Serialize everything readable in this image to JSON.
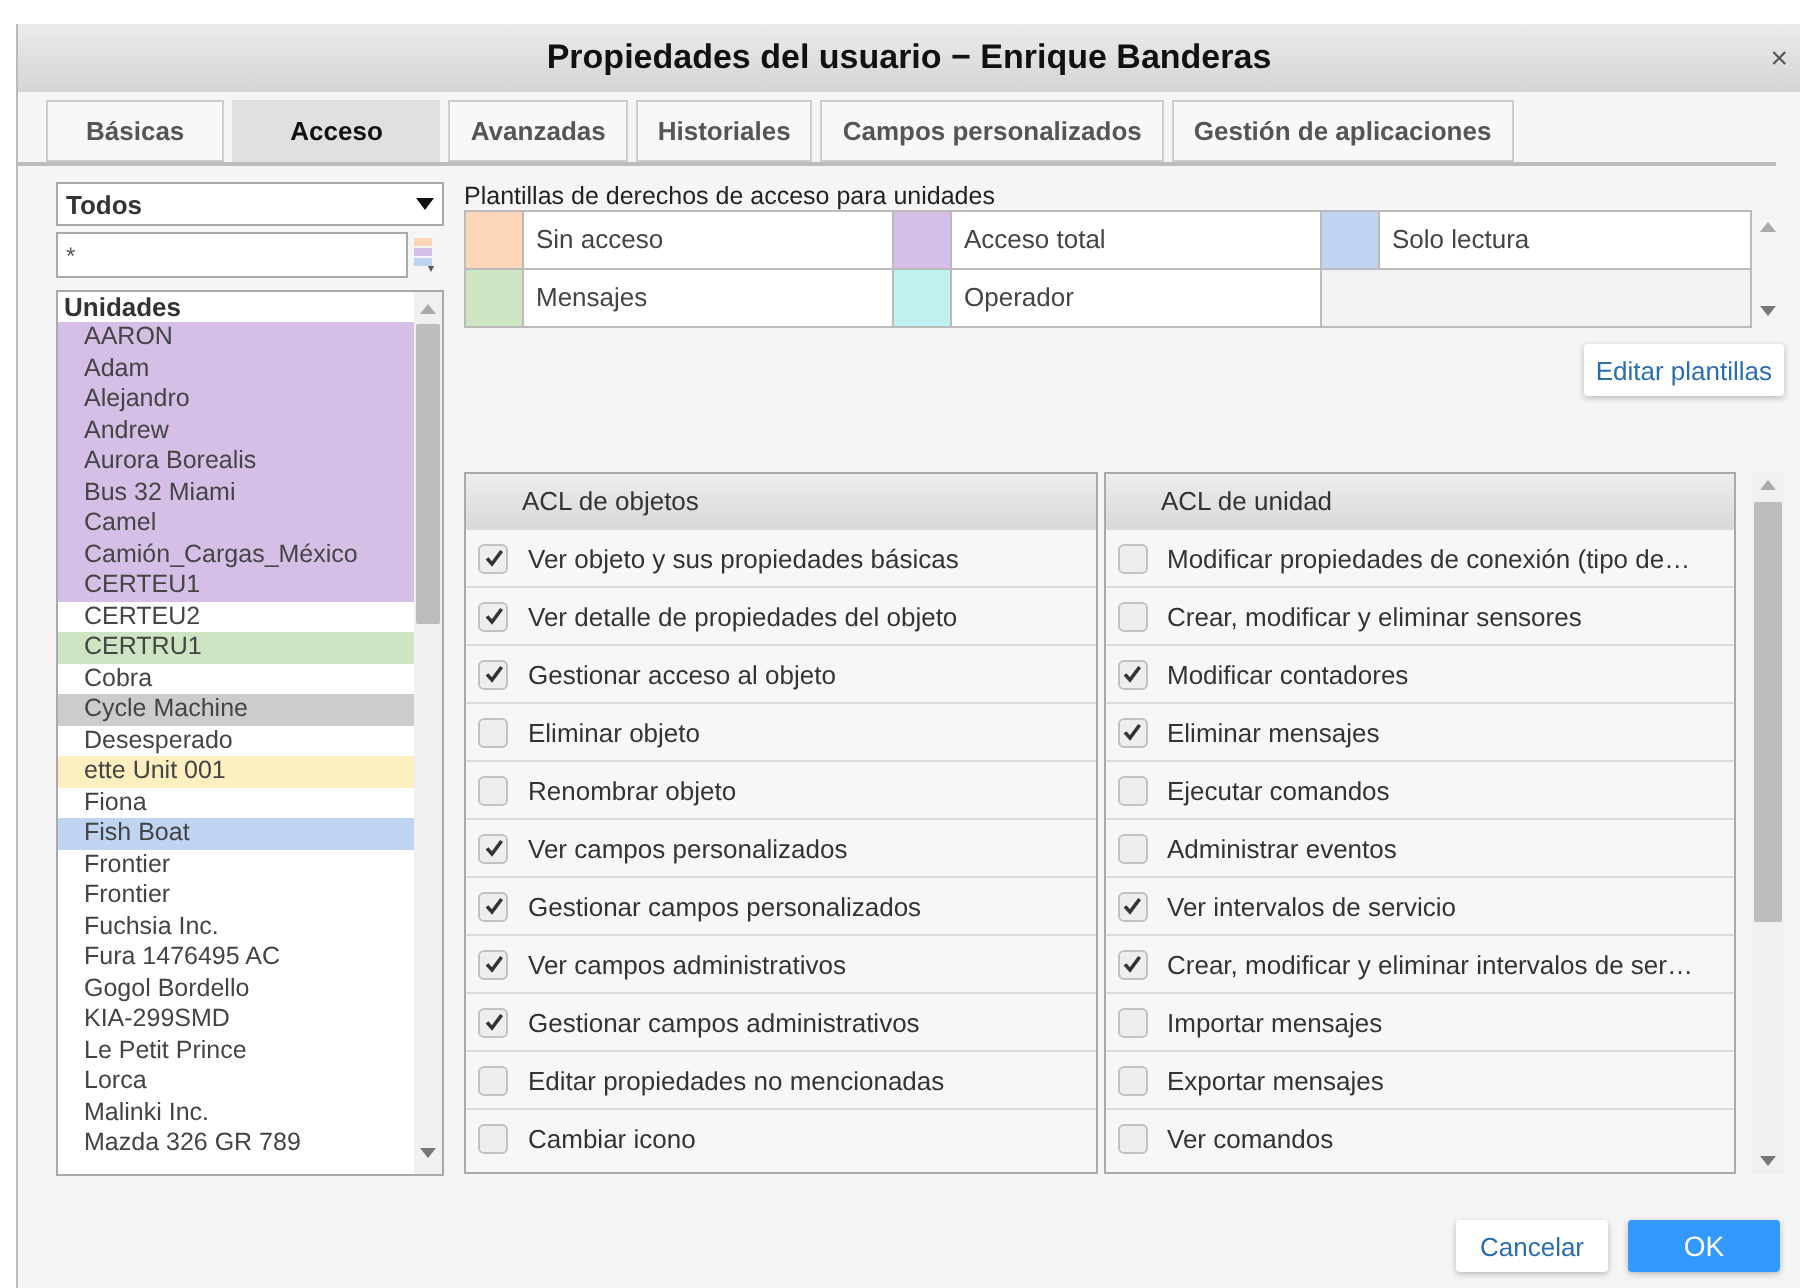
{
  "window": {
    "title": "Propiedades del usuario − Enrique Banderas",
    "close": "×"
  },
  "tabs": [
    {
      "label": "Básicas",
      "selected": false
    },
    {
      "label": "Acceso",
      "selected": true
    },
    {
      "label": "Avanzadas",
      "selected": false
    },
    {
      "label": "Historiales",
      "selected": false
    },
    {
      "label": "Campos personalizados",
      "selected": false
    },
    {
      "label": "Gestión de aplicaciones",
      "selected": false
    }
  ],
  "filter": {
    "value": "Todos"
  },
  "search": {
    "value": "*"
  },
  "units": {
    "header": "Unidades",
    "items": [
      {
        "name": "AARON",
        "color": "#d5bfe6"
      },
      {
        "name": "Adam",
        "color": "#d5bfe6"
      },
      {
        "name": "Alejandro",
        "color": "#d5bfe6"
      },
      {
        "name": "Andrew",
        "color": "#d5bfe6"
      },
      {
        "name": "Aurora Borealis",
        "color": "#d5bfe6"
      },
      {
        "name": "Bus 32 Miami",
        "color": "#d5bfe6"
      },
      {
        "name": "Camel",
        "color": "#d5bfe6"
      },
      {
        "name": "Camión_Cargas_México",
        "color": "#d5bfe6"
      },
      {
        "name": "CERTEU1",
        "color": "#d5bfe6"
      },
      {
        "name": "CERTEU2",
        "color": "#ffffff"
      },
      {
        "name": "CERTRU1",
        "color": "#cde5c3"
      },
      {
        "name": "Cobra",
        "color": "#ffffff"
      },
      {
        "name": "Cycle Machine",
        "color": "#cccccc"
      },
      {
        "name": "Desesperado",
        "color": "#ffffff"
      },
      {
        "name": "ette Unit 001",
        "color": "#fcefc0"
      },
      {
        "name": "Fiona",
        "color": "#ffffff"
      },
      {
        "name": "Fish Boat",
        "color": "#bfd4f1"
      },
      {
        "name": "Frontier",
        "color": "#ffffff"
      },
      {
        "name": "Frontier",
        "color": "#ffffff"
      },
      {
        "name": "Fuchsia Inc.",
        "color": "#ffffff"
      },
      {
        "name": "Fura 1476495 AC",
        "color": "#ffffff"
      },
      {
        "name": "Gogol Bordello",
        "color": "#ffffff"
      },
      {
        "name": "KIA-299SMD",
        "color": "#ffffff"
      },
      {
        "name": "Le Petit Prince",
        "color": "#ffffff"
      },
      {
        "name": "Lorca",
        "color": "#ffffff"
      },
      {
        "name": "Malinki Inc.",
        "color": "#ffffff"
      },
      {
        "name": "Mazda 326 GR 789",
        "color": "#ffffff"
      }
    ]
  },
  "templates": {
    "title": "Plantillas de derechos de acceso para unidades",
    "items": [
      {
        "label": "Sin acceso",
        "color": "#fdd5b8"
      },
      {
        "label": "Acceso total",
        "color": "#d5bfe6"
      },
      {
        "label": "Solo lectura",
        "color": "#bfd4f1"
      },
      {
        "label": "Mensajes",
        "color": "#cde5c3"
      },
      {
        "label": "Operador",
        "color": "#c0f0f0"
      }
    ],
    "edit_button": "Editar plantillas"
  },
  "acl_objects": {
    "header": "ACL de objetos",
    "items": [
      {
        "label": "Ver objeto y sus propiedades básicas",
        "checked": true
      },
      {
        "label": "Ver detalle de propiedades del objeto",
        "checked": true
      },
      {
        "label": "Gestionar acceso al objeto",
        "checked": true
      },
      {
        "label": "Eliminar objeto",
        "checked": false
      },
      {
        "label": "Renombrar objeto",
        "checked": false
      },
      {
        "label": "Ver campos personalizados",
        "checked": true
      },
      {
        "label": "Gestionar campos personalizados",
        "checked": true
      },
      {
        "label": "Ver campos administrativos",
        "checked": true
      },
      {
        "label": "Gestionar campos administrativos",
        "checked": true
      },
      {
        "label": "Editar propiedades no mencionadas",
        "checked": false
      },
      {
        "label": "Cambiar icono",
        "checked": false
      }
    ]
  },
  "acl_unit": {
    "header": "ACL de unidad",
    "items": [
      {
        "label": "Modificar propiedades de conexión (tipo de…",
        "checked": false
      },
      {
        "label": "Crear, modificar y eliminar sensores",
        "checked": false
      },
      {
        "label": "Modificar contadores",
        "checked": true
      },
      {
        "label": "Eliminar mensajes",
        "checked": true
      },
      {
        "label": "Ejecutar comandos",
        "checked": false
      },
      {
        "label": "Administrar eventos",
        "checked": false
      },
      {
        "label": "Ver intervalos de servicio",
        "checked": true
      },
      {
        "label": "Crear, modificar y eliminar intervalos de ser…",
        "checked": true
      },
      {
        "label": "Importar mensajes",
        "checked": false
      },
      {
        "label": "Exportar mensajes",
        "checked": false
      },
      {
        "label": "Ver comandos",
        "checked": false
      }
    ]
  },
  "buttons": [
    {
      "label": "Cancelar",
      "kind": "secondary"
    },
    {
      "label": "OK",
      "kind": "primary"
    }
  ]
}
